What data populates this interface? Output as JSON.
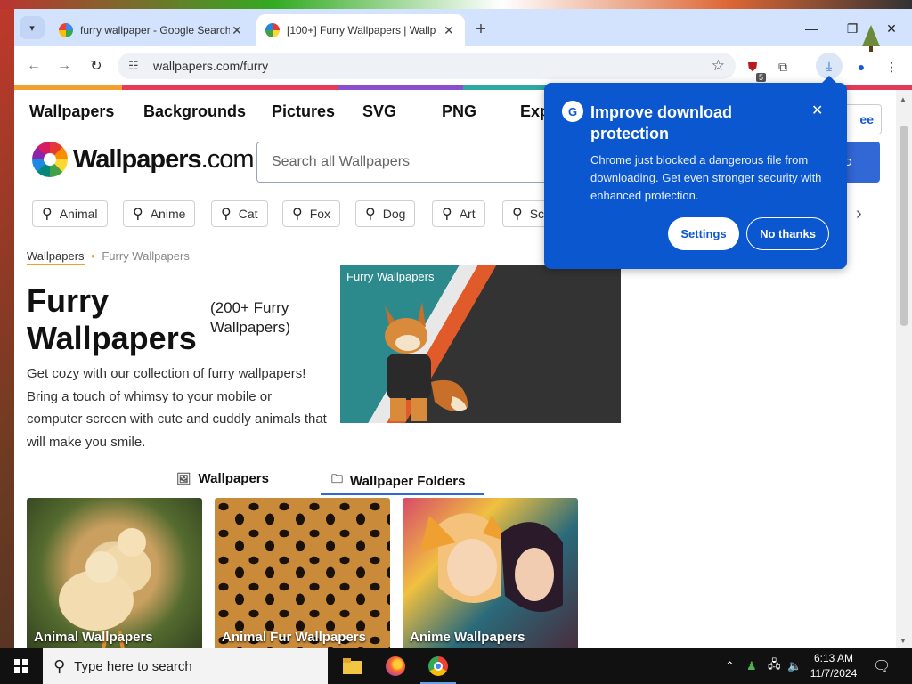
{
  "browser": {
    "tabs": [
      {
        "title": "furry wallpaper - Google Search",
        "active": false,
        "favicon": "google-favicon-icon"
      },
      {
        "title": "[100+] Furry Wallpapers | Wallp",
        "active": true,
        "favicon": "wallpapers-favicon-icon"
      }
    ],
    "new_tab_label": "+",
    "url": "wallpapers.com/furry",
    "extension_badge": "5"
  },
  "site": {
    "nav": [
      "Wallpapers",
      "Backgrounds",
      "Pictures",
      "SVG",
      "PNG",
      "Exp"
    ],
    "free_button": "ee",
    "logo_text": "Wallpapers",
    "logo_suffix": ".com",
    "search_placeholder": "Search all Wallpapers",
    "chips": [
      "Animal",
      "Anime",
      "Cat",
      "Fox",
      "Dog",
      "Art",
      "Sc"
    ],
    "breadcrumb": {
      "first": "Wallpapers",
      "separator": "•",
      "current": "Furry Wallpapers"
    },
    "title": "Furry Wallpapers",
    "subtitle": "(200+ Furry Wallpapers)",
    "description": "Get cozy with our collection of furry wallpapers! Bring a touch of whimsy to your mobile or computer screen with cute and cuddly animals that will make you smile.",
    "hero_caption": "Furry Wallpapers",
    "page_tabs": [
      "Wallpapers",
      "Wallpaper Folders"
    ],
    "tiles": [
      "Animal Wallpapers",
      "Animal Fur Wallpapers",
      "Anime Wallpapers"
    ]
  },
  "popup": {
    "title": "Improve download protection",
    "body": "Chrome just blocked a dangerous file from downloading. Get even stronger security with enhanced protection.",
    "settings_label": "Settings",
    "no_thanks_label": "No thanks",
    "close_label": "✕",
    "accent": "#0b57d0"
  },
  "taskbar": {
    "search_placeholder": "Type here to search",
    "time": "6:13 AM",
    "date": "11/7/2024"
  }
}
